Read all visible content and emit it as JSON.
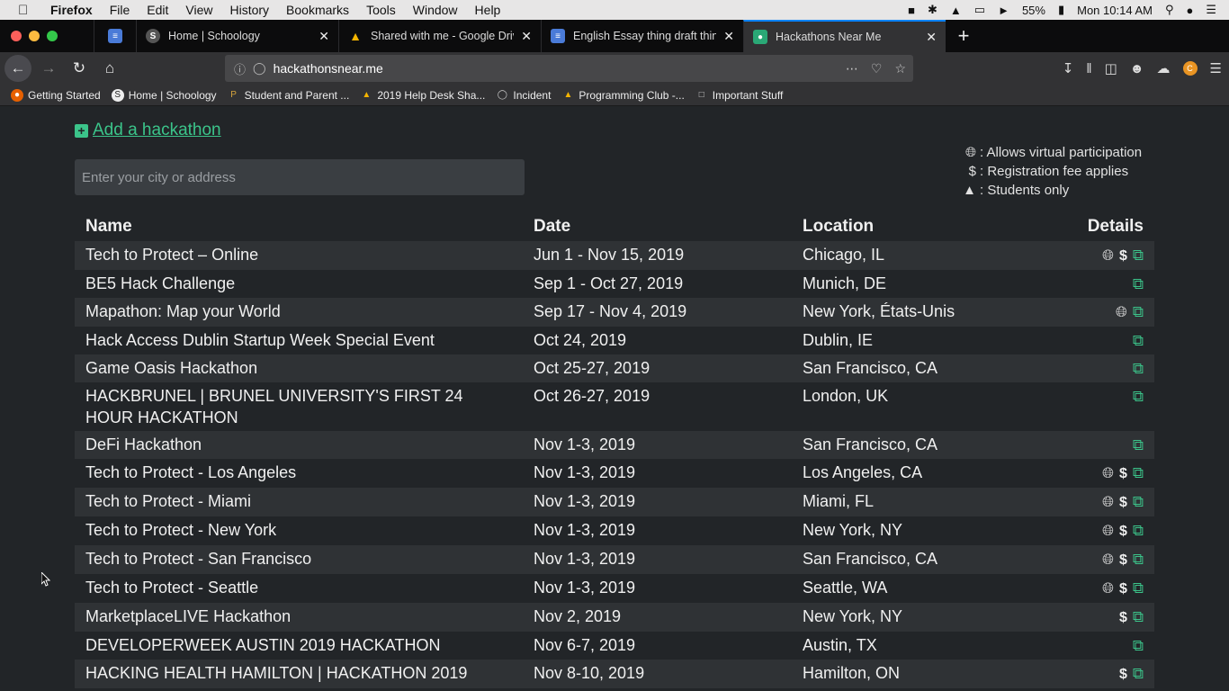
{
  "menubar": {
    "app": "Firefox",
    "items": [
      "File",
      "Edit",
      "View",
      "History",
      "Bookmarks",
      "Tools",
      "Window",
      "Help"
    ],
    "battery": "55%",
    "clock": "Mon 10:14 AM"
  },
  "tabs": [
    {
      "title": "",
      "icon": "docs-icon",
      "color": "#4a7bd8"
    },
    {
      "title": "Home | Schoology",
      "icon": "schoology-icon",
      "color": "#555"
    },
    {
      "title": "Shared with me - Google Drive",
      "icon": "drive-icon",
      "color": "#f4b400"
    },
    {
      "title": "English Essay thing draft thing",
      "icon": "docs-icon",
      "color": "#4a7bd8"
    },
    {
      "title": "Hackathons Near Me",
      "icon": "map-pin-icon",
      "color": "#2aa876"
    }
  ],
  "nav": {
    "url": "hackathonsnear.me"
  },
  "bookmarks": [
    {
      "label": "Getting Started",
      "icon": "firefox-icon"
    },
    {
      "label": "Home | Schoology",
      "icon": "schoology-icon"
    },
    {
      "label": "Student and Parent ...",
      "icon": "bookmark-p-icon"
    },
    {
      "label": "2019 Help Desk Sha...",
      "icon": "drive-icon"
    },
    {
      "label": "Incident",
      "icon": "globe-icon"
    },
    {
      "label": "Programming Club -...",
      "icon": "drive-icon"
    },
    {
      "label": "Important Stuff",
      "icon": "folder-icon"
    }
  ],
  "page": {
    "add_link": "Add a hackathon",
    "search_placeholder": "Enter your city or address",
    "legend": [
      {
        "icon": "globe-icon",
        "text": ": Allows virtual participation"
      },
      {
        "icon": "dollar-icon",
        "text": ": Registration fee applies"
      },
      {
        "icon": "graduation-cap-icon",
        "text": ": Students only"
      }
    ],
    "headers": {
      "name": "Name",
      "date": "Date",
      "location": "Location",
      "details": "Details"
    },
    "rows": [
      {
        "name": "Tech to Protect – Online",
        "date": "Jun 1 - Nov 15, 2019",
        "location": "Chicago, IL",
        "virtual": true,
        "fee": true
      },
      {
        "name": "BE5 Hack Challenge",
        "date": "Sep 1 - Oct 27, 2019",
        "location": "Munich, DE",
        "virtual": false,
        "fee": false
      },
      {
        "name": "Mapathon: Map your World",
        "date": "Sep 17 - Nov 4, 2019",
        "location": "New York, États-Unis",
        "virtual": true,
        "fee": false
      },
      {
        "name": "Hack Access Dublin Startup Week Special Event",
        "date": "Oct 24, 2019",
        "location": "Dublin, IE",
        "virtual": false,
        "fee": false
      },
      {
        "name": "Game Oasis Hackathon",
        "date": "Oct 25-27, 2019",
        "location": "San Francisco, CA",
        "virtual": false,
        "fee": false
      },
      {
        "name": "HACKBRUNEL | BRUNEL UNIVERSITY'S FIRST 24 HOUR HACKATHON",
        "date": "Oct 26-27, 2019",
        "location": "London, UK",
        "virtual": false,
        "fee": false
      },
      {
        "name": "DeFi Hackathon",
        "date": "Nov 1-3, 2019",
        "location": "San Francisco, CA",
        "virtual": false,
        "fee": false
      },
      {
        "name": "Tech to Protect - Los Angeles",
        "date": "Nov 1-3, 2019",
        "location": "Los Angeles, CA",
        "virtual": true,
        "fee": true
      },
      {
        "name": "Tech to Protect - Miami",
        "date": "Nov 1-3, 2019",
        "location": "Miami, FL",
        "virtual": true,
        "fee": true
      },
      {
        "name": "Tech to Protect - New York",
        "date": "Nov 1-3, 2019",
        "location": "New York, NY",
        "virtual": true,
        "fee": true
      },
      {
        "name": "Tech to Protect - San Francisco",
        "date": "Nov 1-3, 2019",
        "location": "San Francisco, CA",
        "virtual": true,
        "fee": true
      },
      {
        "name": "Tech to Protect - Seattle",
        "date": "Nov 1-3, 2019",
        "location": "Seattle, WA",
        "virtual": true,
        "fee": true
      },
      {
        "name": "MarketplaceLIVE Hackathon",
        "date": "Nov 2, 2019",
        "location": "New York, NY",
        "virtual": false,
        "fee": true
      },
      {
        "name": "DEVELOPERWEEK AUSTIN 2019 HACKATHON",
        "date": "Nov 6-7, 2019",
        "location": "Austin, TX",
        "virtual": false,
        "fee": false
      },
      {
        "name": "HACKING HEALTH HAMILTON | HACKATHON 2019",
        "date": "Nov 8-10, 2019",
        "location": "Hamilton, ON",
        "virtual": false,
        "fee": true
      }
    ]
  },
  "colors": {
    "accent": "#3bc48a",
    "page_bg": "#222528",
    "row_alt": "#2f3235"
  }
}
